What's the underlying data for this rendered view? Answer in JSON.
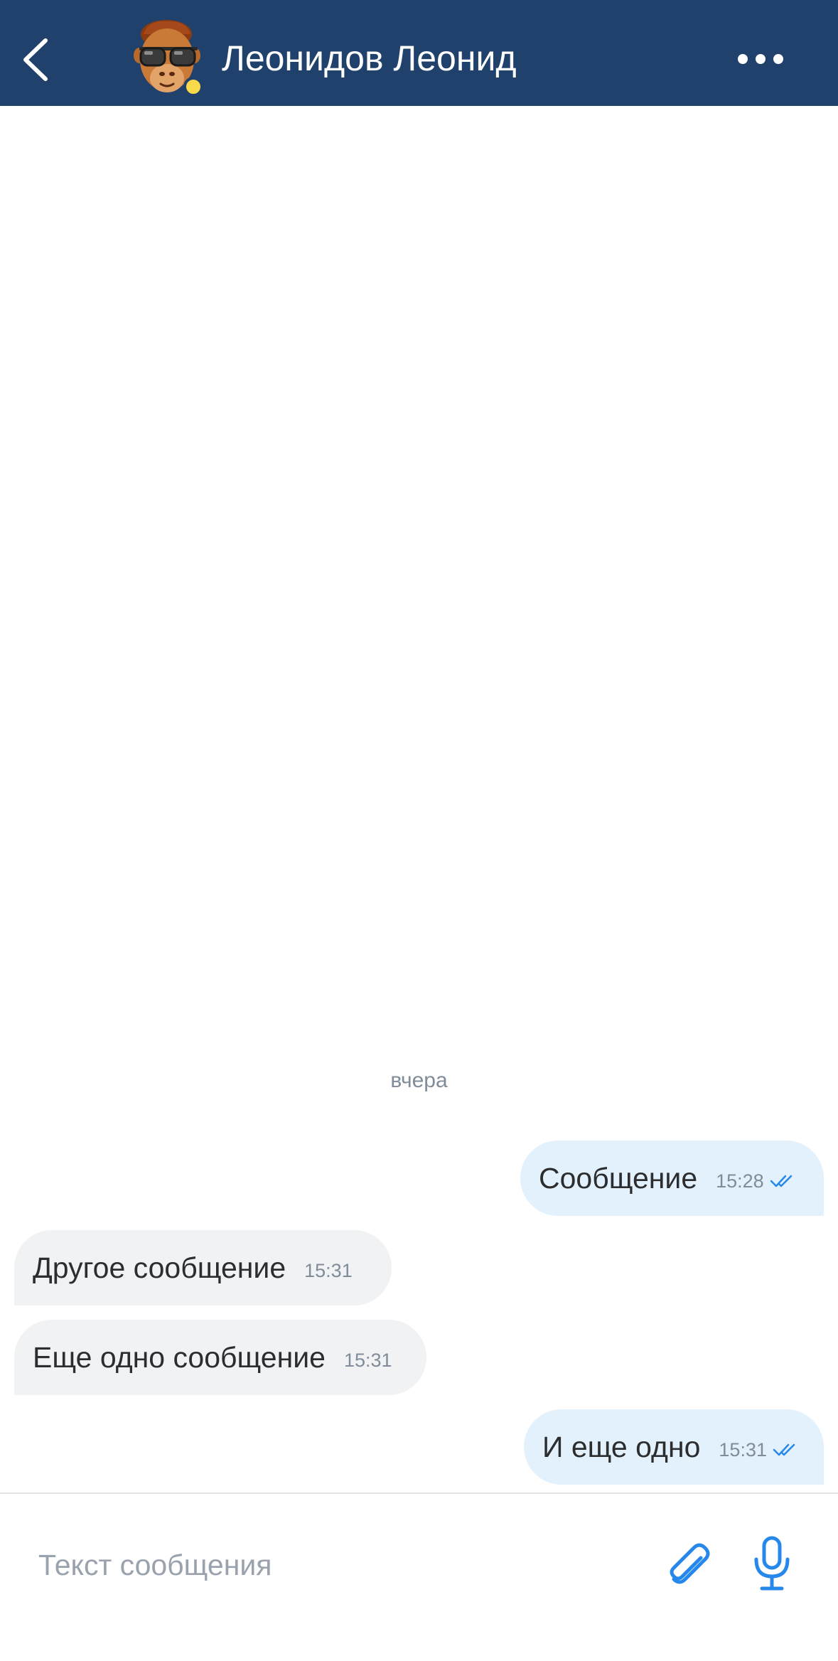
{
  "header": {
    "contact_name": "Леонидов Леонид",
    "back_icon": "chevron-left-icon",
    "more_icon": "more-horizontal-icon",
    "avatar_status": "online",
    "background_color": "#1f416b"
  },
  "chat": {
    "date_separator": "вчера",
    "messages": [
      {
        "direction": "outgoing",
        "text": "Сообщение",
        "time": "15:28",
        "read": true
      },
      {
        "direction": "incoming",
        "text": "Другое сообщение",
        "time": "15:31"
      },
      {
        "direction": "incoming",
        "text": "Еще одно сообщение",
        "time": "15:31"
      },
      {
        "direction": "outgoing",
        "text": "И еще одно",
        "time": "15:31",
        "read": true
      }
    ]
  },
  "composer": {
    "placeholder": "Текст сообщения",
    "value": "",
    "attach_icon": "paperclip-icon",
    "mic_icon": "microphone-icon"
  },
  "colors": {
    "accent": "#2688eb",
    "outgoing_bubble": "#e3f1fc",
    "incoming_bubble": "#f1f2f4",
    "status_dot": "#f8d94a"
  }
}
